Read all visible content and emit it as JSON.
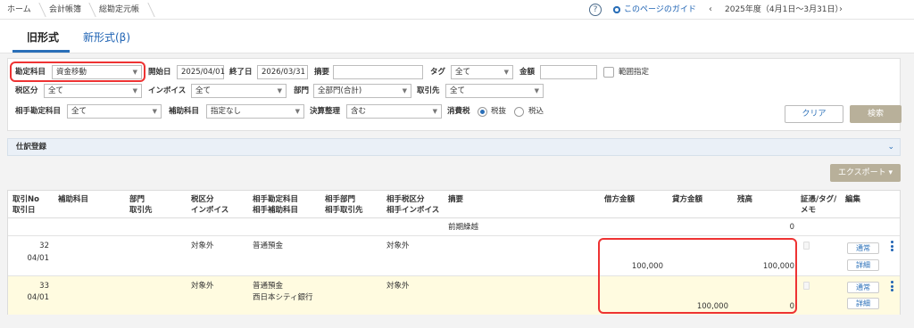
{
  "breadcrumb": [
    "ホーム",
    "会計帳簿",
    "総勘定元帳"
  ],
  "header": {
    "help_icon_glyph": "?",
    "guide_label": "このページのガイド",
    "fiscal_year_label": "2025年度（4月1日〜3月31日）",
    "prev_glyph": "‹",
    "next_glyph": "›"
  },
  "tabs": [
    {
      "label": "旧形式",
      "active": true
    },
    {
      "label": "新形式(β)",
      "active": false
    }
  ],
  "filters": {
    "account_label": "勘定科目",
    "account_value": "資金移動",
    "start_label": "開始日",
    "start_value": "2025/04/01",
    "end_label": "終了日",
    "end_value": "2026/03/31",
    "summary_label": "摘要",
    "tag_label": "タグ",
    "tag_value": "全て",
    "amount_label": "金額",
    "range_label": "範囲指定",
    "tax_label": "税区分",
    "tax_value": "全て",
    "invoice_label": "インボイス",
    "invoice_value": "全て",
    "dept_label": "部門",
    "dept_value": "全部門(合計)",
    "partner_label": "取引先",
    "partner_value": "全て",
    "counter_account_label": "相手勘定科目",
    "counter_account_value": "全て",
    "subaccount_label": "補助科目",
    "subaccount_value": "指定なし",
    "closing_label": "決算整理",
    "closing_value": "含む",
    "consumption_tax_label": "消費税",
    "tax_excl_label": "税抜",
    "tax_incl_label": "税込",
    "clear_label": "クリア",
    "search_label": "検索"
  },
  "journal": {
    "label": "仕訳登録",
    "chevron": "⌄"
  },
  "export_label": "エクスポート ▾",
  "table": {
    "headers": {
      "id": [
        "取引No",
        "取引日"
      ],
      "sub": [
        "補助科目"
      ],
      "dept": [
        "部門",
        "取引先"
      ],
      "tax": [
        "税区分",
        "インボイス"
      ],
      "counter": [
        "相手勘定科目",
        "相手補助科目"
      ],
      "cdept": [
        "相手部門",
        "相手取引先"
      ],
      "ctax": [
        "相手税区分",
        "相手インボイス"
      ],
      "summary": [
        "摘要"
      ],
      "debit": [
        "借方金額"
      ],
      "credit": [
        "貸方金額"
      ],
      "balance": [
        "残高"
      ],
      "evidence": [
        "証憑/タグ/",
        "メモ"
      ],
      "edit": [
        "編集"
      ]
    },
    "carryover": {
      "summary": "前期繰越",
      "balance": "0"
    },
    "rows": [
      {
        "no": "32",
        "date": "04/01",
        "tax": "対象外",
        "counter_account": "普通預金",
        "counter_sub": "",
        "counter_tax": "対象外",
        "debit": "100,000",
        "credit": "",
        "balance": "100,000",
        "btn_status": "通常",
        "btn_detail": "詳細"
      },
      {
        "no": "33",
        "date": "04/01",
        "tax": "対象外",
        "counter_account": "普通預金",
        "counter_sub": "西日本シティ銀行",
        "counter_tax": "対象外",
        "debit": "",
        "credit": "100,000",
        "balance": "0",
        "btn_status": "通常",
        "btn_detail": "詳細"
      }
    ]
  },
  "colors": {
    "accent": "#2a6fb8",
    "highlight_row": "#fffbe0",
    "annotation": "#ee3333",
    "button_muted": "#b8b09a"
  }
}
